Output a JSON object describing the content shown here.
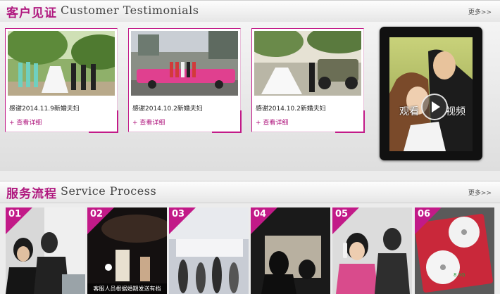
{
  "testimonials": {
    "title_zh": "客户见证",
    "title_en": "Customer Testimonials",
    "more": "更多>>",
    "cards": [
      {
        "caption": "感谢2014.11.9新婚夫妇",
        "link": "+ 查看详细"
      },
      {
        "caption": "感谢2014.10.2新婚夫妇",
        "link": "+ 查看详细"
      },
      {
        "caption": "感谢2014.10.2新婚夫妇",
        "link": "+ 查看详细"
      }
    ],
    "video": {
      "label_left": "观看",
      "label_right": "视频"
    }
  },
  "service": {
    "title_zh": "服务流程",
    "title_en": "Service Process",
    "more": "更多>>",
    "steps": [
      {
        "num": "01",
        "caption": ""
      },
      {
        "num": "02",
        "caption": "客服人员根据婚期发送有档"
      },
      {
        "num": "03",
        "caption": ""
      },
      {
        "num": "04",
        "caption": ""
      },
      {
        "num": "05",
        "caption": ""
      },
      {
        "num": "06",
        "caption": ""
      }
    ]
  },
  "colors": {
    "accent": "#b0197f",
    "card_border": "#c21a88"
  }
}
